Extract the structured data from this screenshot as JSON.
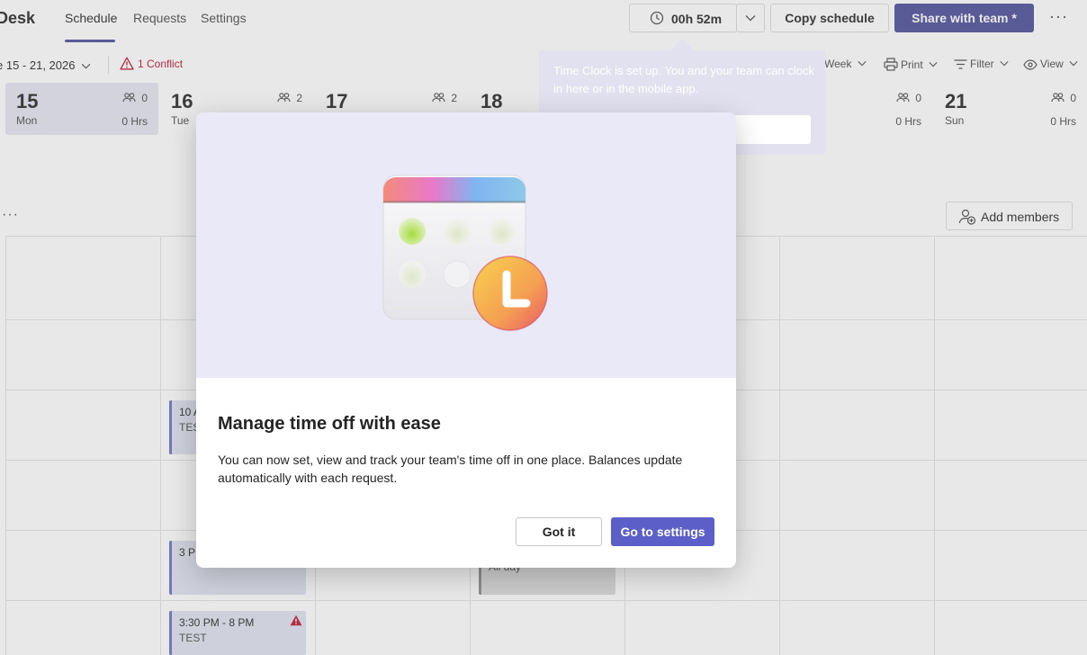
{
  "app": {
    "name": "Desk"
  },
  "nav": {
    "tabs": [
      "Schedule",
      "Requests",
      "Settings"
    ]
  },
  "header": {
    "clock_time": "00h 52m",
    "copy_schedule": "Copy schedule",
    "share_with_team": "Share with team *",
    "more": "···"
  },
  "toolbar": {
    "date_range": "e 15 - 21, 2026",
    "conflict": "1 Conflict",
    "week": "Week",
    "print": "Print",
    "filter": "Filter",
    "view": "View"
  },
  "days": [
    {
      "num": "15",
      "name": "Mon",
      "people": "0",
      "hours": "0 Hrs"
    },
    {
      "num": "16",
      "name": "Tue",
      "people": "2",
      "hours": ""
    },
    {
      "num": "17",
      "name": "",
      "people": "2",
      "hours": ""
    },
    {
      "num": "18",
      "name": "",
      "people": "",
      "hours": ""
    },
    {
      "num": "",
      "name": "",
      "people": "",
      "hours": ""
    },
    {
      "num": "",
      "name": "",
      "people": "0",
      "hours": "0 Hrs"
    },
    {
      "num": "21",
      "name": "Sun",
      "people": "0",
      "hours": "0 Hrs"
    }
  ],
  "members": {
    "dots": "···",
    "add_members": "Add members"
  },
  "shifts": [
    {
      "time": "10 A",
      "label": "TES"
    },
    {
      "time": "3 P",
      "label": ""
    },
    {
      "time": "",
      "label": "All day"
    },
    {
      "time": "3:30 PM - 8 PM",
      "label": "TEST"
    }
  ],
  "coachmark": {
    "text": "Time Clock is set up. You and your team can clock in here or in the mobile app."
  },
  "dialog": {
    "title": "Manage time off with ease",
    "body": "You can now set, view and track your team's time off in one place. Balances update automatically with each request.",
    "got_it": "Got it",
    "go_to_settings": "Go to settings"
  },
  "colors": {
    "brand": "#6264a7",
    "primary_button": "#5b5fc7",
    "conflict": "#c4314b",
    "hero_bg": "#e9e9f7"
  }
}
